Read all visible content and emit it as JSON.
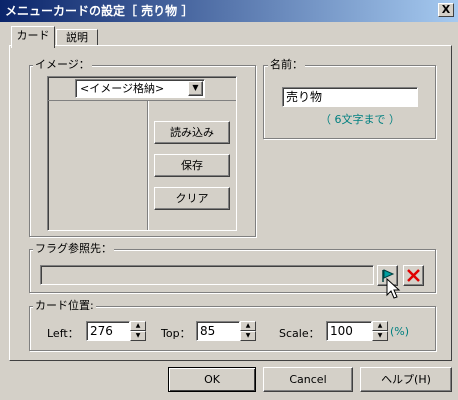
{
  "window": {
    "title": "メニューカードの設定［ 売り物 ］",
    "close_label": "X"
  },
  "tabs": [
    {
      "label": "カード"
    },
    {
      "label": "説明"
    }
  ],
  "image_group": {
    "label": "イメージ：",
    "dropdown_value": "<イメージ格納>",
    "load_label": "読み込み",
    "save_label": "保存",
    "clear_label": "クリア"
  },
  "name_group": {
    "label": "名前：",
    "value": "売り物",
    "hint": "（ 6文字まで ）",
    "hint_color": "#008080"
  },
  "flag_group": {
    "label": "フラグ参照先：",
    "value": ""
  },
  "position_group": {
    "label": "カード位置:",
    "left_label": "Left：",
    "left_value": "276",
    "top_label": "Top：",
    "top_value": "85",
    "scale_label": "Scale：",
    "scale_value": "100",
    "unit": "(%)"
  },
  "footer": {
    "ok_label": "OK",
    "cancel_label": "Cancel",
    "help_label": "ヘルプ(H)"
  },
  "icons": {
    "flag": "flag-icon",
    "clear": "x-icon",
    "cursor": "mouse-cursor"
  }
}
